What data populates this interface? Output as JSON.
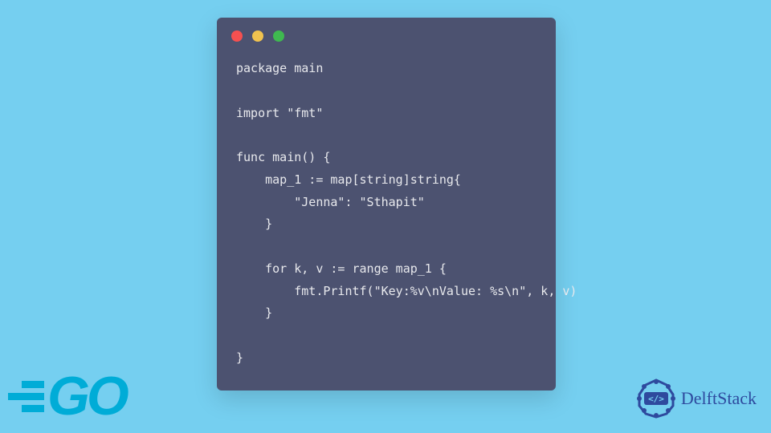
{
  "window": {
    "dots": {
      "red": "#F55050",
      "yellow": "#F0C24F",
      "green": "#3FB950"
    }
  },
  "code": {
    "line1": "package main",
    "line2": "",
    "line3": "import \"fmt\"",
    "line4": "",
    "line5": "func main() {",
    "line6": "    map_1 := map[string]string{",
    "line7": "        \"Jenna\": \"Sthapit\"",
    "line8": "    }",
    "line9": "",
    "line10": "    for k, v := range map_1 {",
    "line11": "        fmt.Printf(\"Key:%v\\nValue: %s\\n\", k, v)",
    "line12": "    }",
    "line13": "",
    "line14": "}"
  },
  "logos": {
    "go": "GO",
    "delft": "DelftStack",
    "delft_glyph": "</>"
  }
}
